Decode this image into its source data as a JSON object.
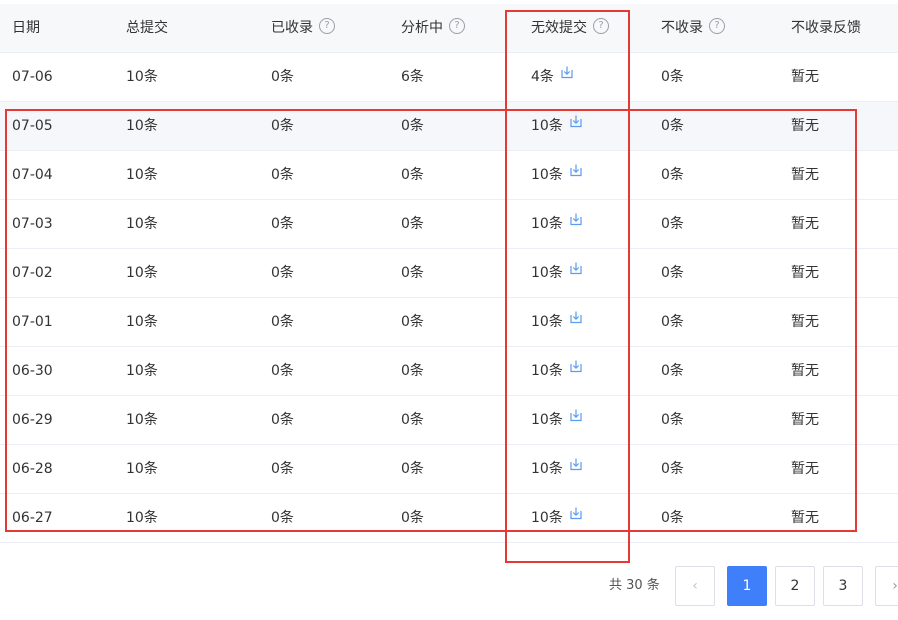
{
  "columns": [
    "日期",
    "总提交",
    "已收录",
    "分析中",
    "无效提交",
    "不收录",
    "不收录反馈"
  ],
  "rows": [
    {
      "date": "07-06",
      "total": "10条",
      "indexed": "0条",
      "analyzing": "6条",
      "invalid": "4条",
      "not_indexed": "0条",
      "feedback": "暂无"
    },
    {
      "date": "07-05",
      "total": "10条",
      "indexed": "0条",
      "analyzing": "0条",
      "invalid": "10条",
      "not_indexed": "0条",
      "feedback": "暂无"
    },
    {
      "date": "07-04",
      "total": "10条",
      "indexed": "0条",
      "analyzing": "0条",
      "invalid": "10条",
      "not_indexed": "0条",
      "feedback": "暂无"
    },
    {
      "date": "07-03",
      "total": "10条",
      "indexed": "0条",
      "analyzing": "0条",
      "invalid": "10条",
      "not_indexed": "0条",
      "feedback": "暂无"
    },
    {
      "date": "07-02",
      "total": "10条",
      "indexed": "0条",
      "analyzing": "0条",
      "invalid": "10条",
      "not_indexed": "0条",
      "feedback": "暂无"
    },
    {
      "date": "07-01",
      "total": "10条",
      "indexed": "0条",
      "analyzing": "0条",
      "invalid": "10条",
      "not_indexed": "0条",
      "feedback": "暂无"
    },
    {
      "date": "06-30",
      "total": "10条",
      "indexed": "0条",
      "analyzing": "0条",
      "invalid": "10条",
      "not_indexed": "0条",
      "feedback": "暂无"
    },
    {
      "date": "06-29",
      "total": "10条",
      "indexed": "0条",
      "analyzing": "0条",
      "invalid": "10条",
      "not_indexed": "0条",
      "feedback": "暂无"
    },
    {
      "date": "06-28",
      "total": "10条",
      "indexed": "0条",
      "analyzing": "0条",
      "invalid": "10条",
      "not_indexed": "0条",
      "feedback": "暂无"
    },
    {
      "date": "06-27",
      "total": "10条",
      "indexed": "0条",
      "analyzing": "0条",
      "invalid": "10条",
      "not_indexed": "0条",
      "feedback": "暂无"
    }
  ],
  "help_icon_glyph": "?",
  "pagination": {
    "total_label": "共 30 条",
    "prev": "‹",
    "pages": [
      "1",
      "2",
      "3"
    ],
    "next": "›",
    "active_page": "1"
  },
  "colors": {
    "annotation": "#e53935",
    "accent": "#3f7ff9",
    "download_icon": "#5b9bf0"
  }
}
